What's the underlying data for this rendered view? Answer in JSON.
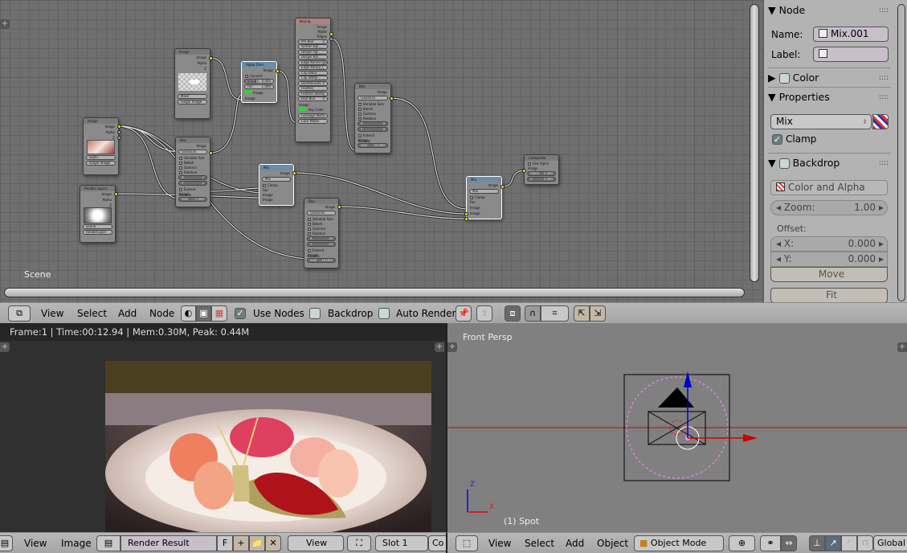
{
  "node_editor": {
    "scene_label": "Scene",
    "nodes": {
      "image1": {
        "title": "Image",
        "outputs": [
          "Image",
          "Alpha",
          "Z"
        ],
        "image_name": "Sushi",
        "source": "Single Image"
      },
      "image2": {
        "title": "Image",
        "outputs": [
          "Image",
          "Alpha",
          "Z"
        ],
        "image_name": "Mask",
        "source": "Single Image"
      },
      "render_layers": {
        "title": "Render Layers",
        "outputs": [
          "Image",
          "Alpha",
          "Z"
        ],
        "scene": "Scene",
        "layer": "RenderLayer"
      },
      "alpha_over": {
        "title": "Alpha Over",
        "output": "Image",
        "convert_premul": "Convert Premul",
        "premul": "Premul",
        "premul_value": "0.000",
        "fac": "Fac",
        "fac_value": "1.000",
        "inputs": [
          "Image",
          "Image"
        ]
      },
      "keying": {
        "title": "Keying",
        "outputs": [
          "Image",
          "Matte",
          "Edges"
        ],
        "fields": [
          [
            "Pre Blur",
            "0"
          ],
          [
            "Screen Bal",
            "0.500"
          ],
          [
            "Despill Fac",
            "1.000"
          ],
          [
            "Despill Bal",
            "0.500"
          ],
          [
            "Edge Kernel Radi",
            "3"
          ],
          [
            "Edge Kernel T",
            "0.100"
          ],
          [
            "Clip Black",
            "0.000"
          ],
          [
            "Clip White",
            "1.000"
          ],
          [
            "Dilate/Erode",
            "0"
          ],
          [
            "Feather",
            "Smooth"
          ],
          [
            "Feather Distan",
            "0"
          ],
          [
            "Post Blur",
            "0"
          ]
        ],
        "inputs": [
          "Image",
          "Key Color",
          "Garbage Matte",
          "Core Matte"
        ]
      },
      "blur1": {
        "title": "Blur",
        "output": "Image",
        "filter": "Gaussian",
        "options": [
          "Variable Size",
          "Bokeh",
          "Gamma",
          "Relative"
        ],
        "x": "2",
        "y": "2",
        "extend": "Extend Bounds",
        "input": "Image",
        "size_label": "Size",
        "size": "1.000"
      },
      "blur2": {
        "title": "Blur",
        "output": "Image",
        "filter": "Gaussian",
        "options": [
          "Variable Size",
          "Bokeh",
          "Gamma",
          "Relative"
        ],
        "x": "4",
        "y": "4",
        "extend": "Extend Bounds",
        "input": "Image",
        "size_label": "Size",
        "size": "10.000"
      },
      "blur3": {
        "title": "Blur",
        "output": "Image",
        "filter": "Gaussian",
        "options": [
          "Variable Size",
          "Bokeh",
          "Gamma",
          "Relative"
        ],
        "x": "10",
        "y": "10",
        "extend": "Extend Bounds",
        "input": "Image",
        "size_label": "Size",
        "size": "10.000"
      },
      "mix1": {
        "title": "Mix",
        "output": "Image",
        "blend": "Mix",
        "clamp": "Clamp",
        "inputs": [
          "Fac",
          "Image",
          "Image"
        ]
      },
      "mix2": {
        "title": "Mix",
        "output": "Image",
        "blend": "Mix",
        "clamp": "Clamp",
        "inputs": [
          "Fac",
          "Image",
          "Image"
        ]
      },
      "composite": {
        "title": "Composite",
        "use_alpha": "Use Alpha",
        "input": "Image",
        "alpha_label": "Alpha",
        "alpha": "1.000",
        "z_label": "Z",
        "z": "1.000"
      }
    }
  },
  "properties": {
    "node_panel": "Node",
    "name_label": "Name:",
    "name_value": "Mix.001",
    "label_label": "Label:",
    "label_value": "",
    "color_panel": "Color",
    "properties_panel": "Properties",
    "blend_mode": "Mix",
    "clamp_label": "Clamp",
    "clamp_checked": true,
    "backdrop_panel": "Backdrop",
    "backdrop_channels": "Color and Alpha",
    "zoom_label": "Zoom:",
    "zoom_value": "1.00",
    "offset_label": "Offset:",
    "x_label": "X:",
    "x_value": "0.000",
    "y_label": "Y:",
    "y_value": "0.000",
    "move_button": "Move",
    "fit_button": "Fit"
  },
  "node_header": {
    "menus": [
      "View",
      "Select",
      "Add",
      "Node"
    ],
    "use_nodes_label": "Use Nodes",
    "use_nodes_checked": true,
    "backdrop_label": "Backdrop",
    "backdrop_checked": false,
    "auto_render_label": "Auto Render",
    "auto_render_checked": false
  },
  "image_editor": {
    "render_info": "Frame:1 | Time:00:12.94 | Mem:0.30M, Peak: 0.44M",
    "menus": [
      "View",
      "Image"
    ],
    "image_name": "Render Result",
    "fake_user": "F",
    "view_mode": "View",
    "slot": "Slot 1",
    "composite_truncated": "Co"
  },
  "view3d": {
    "view_label": "Front Persp",
    "object_label": "(1) Spot",
    "axis_z": "Z",
    "axis_x": "X",
    "menus": [
      "View",
      "Select",
      "Add",
      "Object"
    ],
    "mode": "Object Mode",
    "orientation": "Global"
  },
  "colors": {
    "socket_image": "#e6e600",
    "socket_value": "#a0a0a0",
    "key_color": "#22dd22",
    "x_axis": "#cc0000",
    "z_axis": "#0000cc",
    "lamp_dashes": "#ff88ff"
  }
}
